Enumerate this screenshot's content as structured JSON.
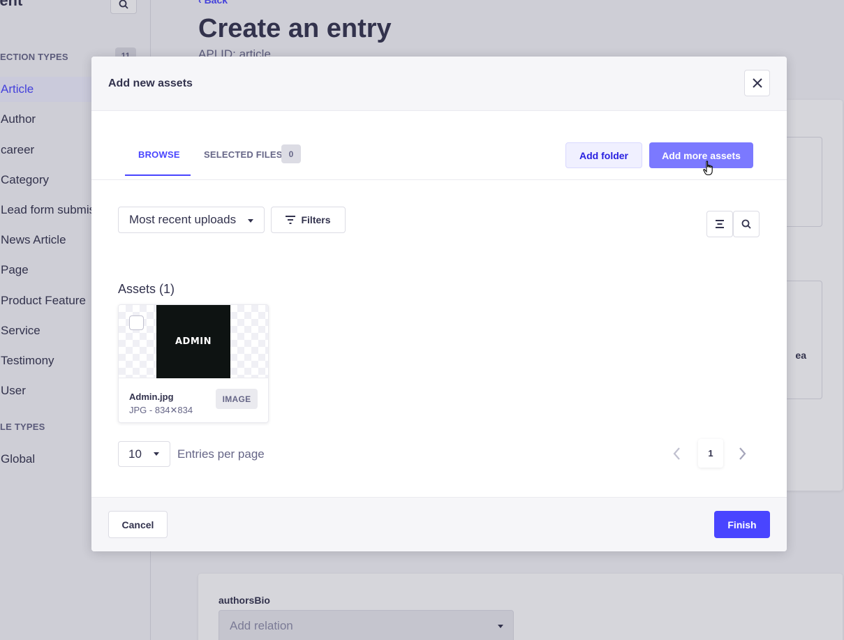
{
  "sidebar": {
    "title": "tent",
    "collection_section": "ECTION TYPES",
    "collection_count": "11",
    "items": [
      {
        "label": "Article",
        "active": true
      },
      {
        "label": "Author"
      },
      {
        "label": "career"
      },
      {
        "label": "Category"
      },
      {
        "label": "Lead form submis"
      },
      {
        "label": "News Article"
      },
      {
        "label": "Page"
      },
      {
        "label": "Product Feature"
      },
      {
        "label": "Service"
      },
      {
        "label": "Testimony"
      },
      {
        "label": "User"
      }
    ],
    "single_section": "LE TYPES",
    "single_items": [
      {
        "label": "Global"
      }
    ]
  },
  "page": {
    "back_label": "Back",
    "title": "Create an entry",
    "subtitle": "API ID: article",
    "partial_text": "ea",
    "authors_label": "authorsBio",
    "relation_placeholder": "Add relation"
  },
  "modal": {
    "title": "Add new assets",
    "tabs": {
      "browse": "BROWSE",
      "selected": "SELECTED FILES",
      "selected_count": "0"
    },
    "add_folder": "Add folder",
    "add_more_assets": "Add more assets",
    "sort_value": "Most recent uploads",
    "filters_label": "Filters",
    "assets_heading": "Assets (1)",
    "asset": {
      "thumb_text": "ADMIN",
      "name": "Admin.jpg",
      "meta": "JPG - 834✕834",
      "type": "IMAGE"
    },
    "per_page_value": "10",
    "per_page_label": "Entries per page",
    "current_page": "1",
    "cancel": "Cancel",
    "finish": "Finish"
  },
  "colors": {
    "primary": "#4945ff",
    "primary_light": "#7b79ff",
    "text": "#32324d",
    "muted": "#666687"
  }
}
